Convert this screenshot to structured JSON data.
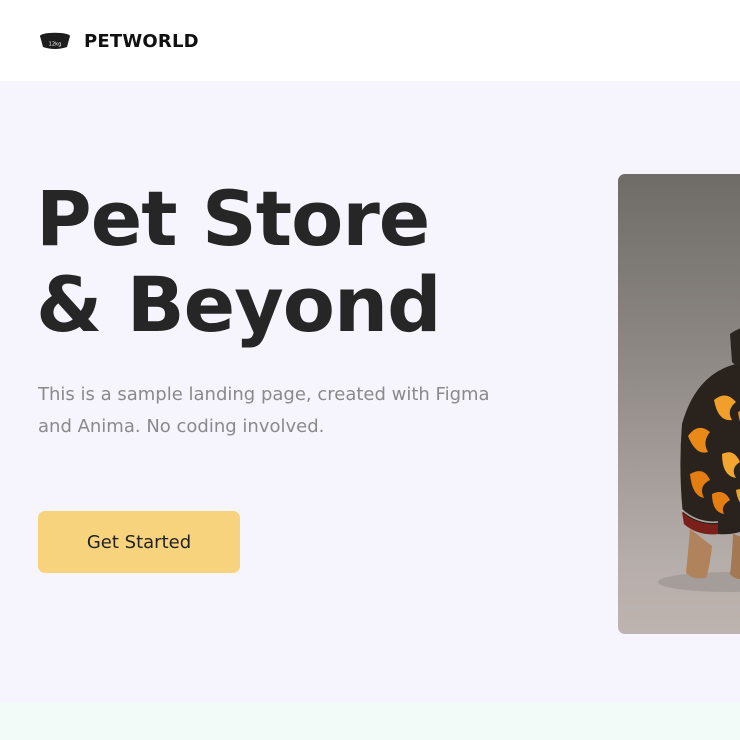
{
  "brand": {
    "name": "PETWORLD",
    "logo_icon": "pet-bowl-icon",
    "logo_icon_text": "12kg"
  },
  "hero": {
    "title_line1": "Pet Store",
    "title_line2": "& Beyond",
    "description": "This is a sample landing page, created with Figma and Anima. No coding involved.",
    "cta_label": "Get Started",
    "image": "dog-in-patterned-sweater-photo"
  },
  "colors": {
    "hero_background": "#f6f5fd",
    "title": "#262626",
    "description": "#8a8a8a",
    "cta_background": "#f8d37d",
    "next_section_background": "#f3fbf8"
  }
}
